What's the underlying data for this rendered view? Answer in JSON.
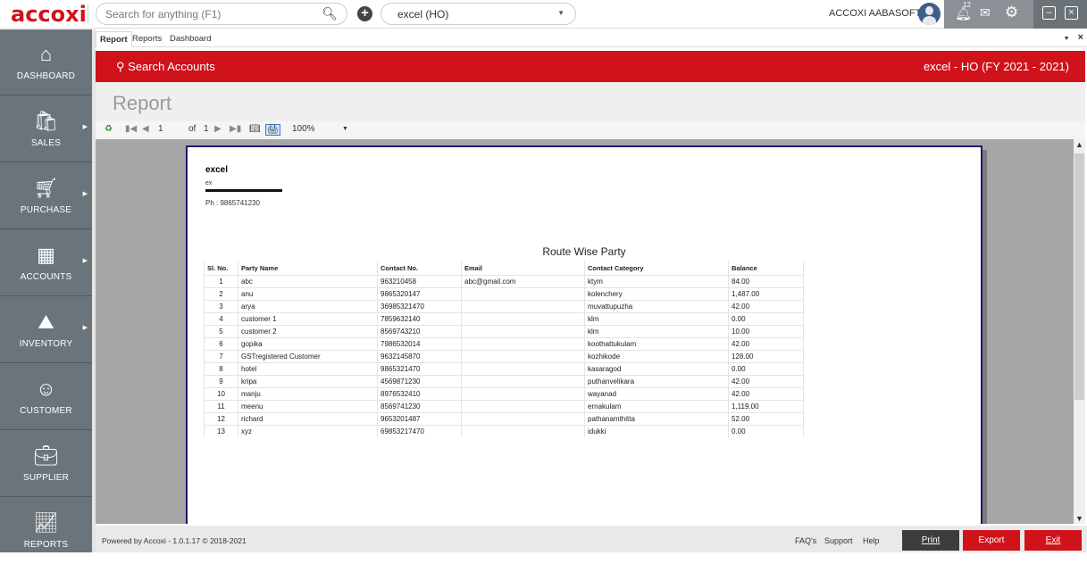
{
  "app": {
    "logo": "accoxi",
    "search_placeholder": "Search for anything (F1)",
    "company_selected": "excel (HO)",
    "user_name": "ACCOXI  AABASOFT",
    "notification_count": "12",
    "brand_color": "#d0121b"
  },
  "sidebar": {
    "items": [
      {
        "label": "DASHBOARD",
        "icon": "home-icon",
        "has_submenu": false
      },
      {
        "label": "SALES",
        "icon": "shopping-bag-icon",
        "has_submenu": true
      },
      {
        "label": "PURCHASE",
        "icon": "cart-icon",
        "has_submenu": true
      },
      {
        "label": "ACCOUNTS",
        "icon": "calculator-icon",
        "has_submenu": true
      },
      {
        "label": "INVENTORY",
        "icon": "trolley-icon",
        "has_submenu": true
      },
      {
        "label": "CUSTOMER",
        "icon": "person-icon",
        "has_submenu": false
      },
      {
        "label": "SUPPLIER",
        "icon": "briefcase-icon",
        "has_submenu": false
      },
      {
        "label": "REPORTS",
        "icon": "chart-icon",
        "has_submenu": false
      }
    ]
  },
  "tabs": [
    {
      "label": "Report",
      "active": true
    },
    {
      "label": "Reports",
      "active": false
    },
    {
      "label": "Dashboard",
      "active": false
    }
  ],
  "header": {
    "search_accounts": "Search Accounts",
    "fiscal_info": "excel - HO (FY 2021 - 2021)",
    "page_title": "Report"
  },
  "toolbar": {
    "current_page": "1",
    "of_label": "of",
    "total_pages": "1",
    "zoom": "100%"
  },
  "report": {
    "company_name": "excel",
    "address": "ex",
    "phone": "Ph : 9865741230",
    "title": "Route Wise Party",
    "columns": [
      "Sl. No.",
      "Party Name",
      "Contact No.",
      "Email",
      "Contact Category",
      "Balance"
    ],
    "rows": [
      [
        "1",
        "abc",
        "963210458",
        "abc@gmail.com",
        "ktym",
        "84.00"
      ],
      [
        "2",
        "anu",
        "9865320147",
        "",
        "kolenchery",
        "1,487.00"
      ],
      [
        "3",
        "arya",
        "36985321470",
        "",
        "muvattupuzha",
        "42.00"
      ],
      [
        "4",
        "customer 1",
        "7859632140",
        "",
        "klm",
        "0.00"
      ],
      [
        "5",
        "customer 2",
        "8569743210",
        "",
        "klm",
        "10.00"
      ],
      [
        "6",
        "gopika",
        "7986532014",
        "",
        "koothattukulam",
        "42.00"
      ],
      [
        "7",
        "GSTregistered Customer",
        "9632145870",
        "",
        "kozhikode",
        "128.00"
      ],
      [
        "8",
        "hotel",
        "9865321470",
        "",
        "kasaragod",
        "0.00"
      ],
      [
        "9",
        "kripa",
        "4569871230",
        "",
        "puthanvelikara",
        "42.00"
      ],
      [
        "10",
        "manju",
        "8976532410",
        "",
        "wayanad",
        "42.00"
      ],
      [
        "11",
        "meenu",
        "8569741230",
        "",
        "ernakulam",
        "1,119.00"
      ],
      [
        "12",
        "richard",
        "9653201487",
        "",
        "pathanamthitta",
        "52.00"
      ],
      [
        "13",
        "xyz",
        "69853217470",
        "",
        "idukki",
        "0.00"
      ]
    ]
  },
  "footer": {
    "powered_by": "Powered by Accoxi - 1.0.1.17 © 2018-2021",
    "faq": "FAQ's",
    "support": "Support",
    "help": "Help",
    "print": "Print",
    "export": "Export",
    "exit": "Exit"
  }
}
